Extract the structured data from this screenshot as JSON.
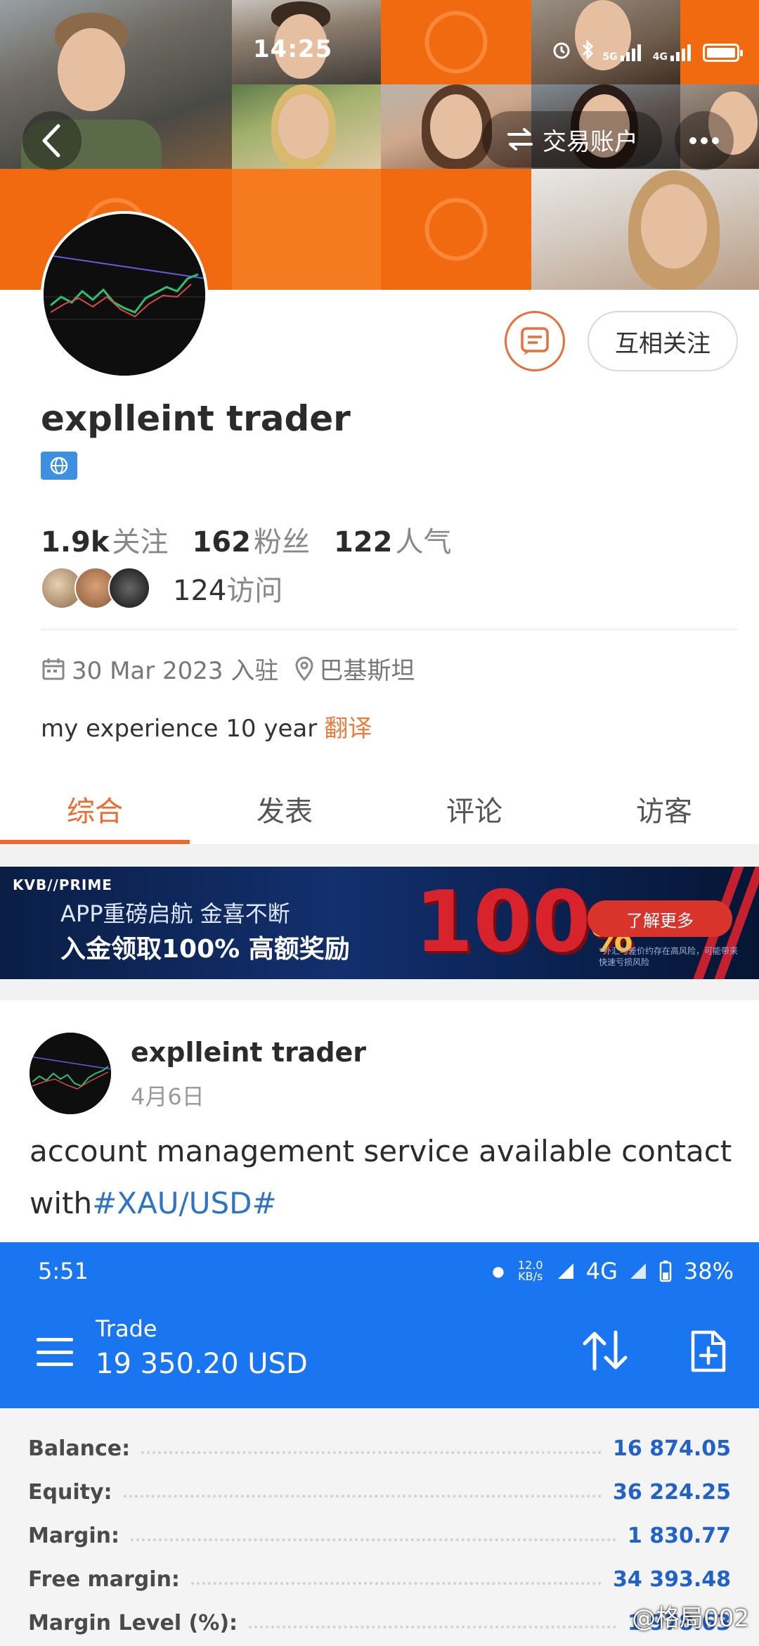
{
  "status_bar": {
    "time": "14:25",
    "network1": "5G",
    "network2": "4G"
  },
  "header": {
    "trade_account_label": "交易账户"
  },
  "profile": {
    "follow_label": "互相关注",
    "username": "explleint trader",
    "stats": [
      {
        "value": "1.9k",
        "label": "关注"
      },
      {
        "value": "162",
        "label": "粉丝"
      },
      {
        "value": "122",
        "label": "人气"
      }
    ],
    "visits": {
      "value": "124",
      "label": "访问"
    },
    "joined": "30 Mar 2023 入驻",
    "location": "巴基斯坦",
    "bio": "my experience 10 year",
    "translate_label": "翻译"
  },
  "tabs": [
    {
      "label": "综合",
      "active": true
    },
    {
      "label": "发表",
      "active": false
    },
    {
      "label": "评论",
      "active": false
    },
    {
      "label": "访客",
      "active": false
    }
  ],
  "ad": {
    "brand": "KVB//PRIME",
    "line1": "APP重磅启航 金喜不断",
    "line2": "入金领取100% 高额奖励",
    "big": "100",
    "pct": "%",
    "button": "了解更多",
    "disclaimer": "*外汇与差价约存在高风险，可能带来快速亏损风险"
  },
  "post": {
    "author": "explleint trader",
    "date": "4月6日",
    "text": "account management service available contact with",
    "hashtag": "#XAU/USD#"
  },
  "screenshot": {
    "time": "5:51",
    "speed": "12.0 KB/s",
    "network": "4G",
    "battery": "38%",
    "title": "Trade",
    "amount": "19 350.20 USD",
    "rows": [
      {
        "label": "Balance:",
        "value": "16 874.05"
      },
      {
        "label": "Equity:",
        "value": "36 224.25"
      },
      {
        "label": "Margin:",
        "value": "1 830.77"
      },
      {
        "label": "Free margin:",
        "value": "34 393.48"
      },
      {
        "label": "Margin Level (%):",
        "value": "1 978.63"
      }
    ]
  },
  "watermark": "@格局002",
  "colors": {
    "accent": "#ee6a2e",
    "link": "#2f74c0",
    "trade_blue": "#1976f0",
    "value_blue": "#2062c8"
  }
}
